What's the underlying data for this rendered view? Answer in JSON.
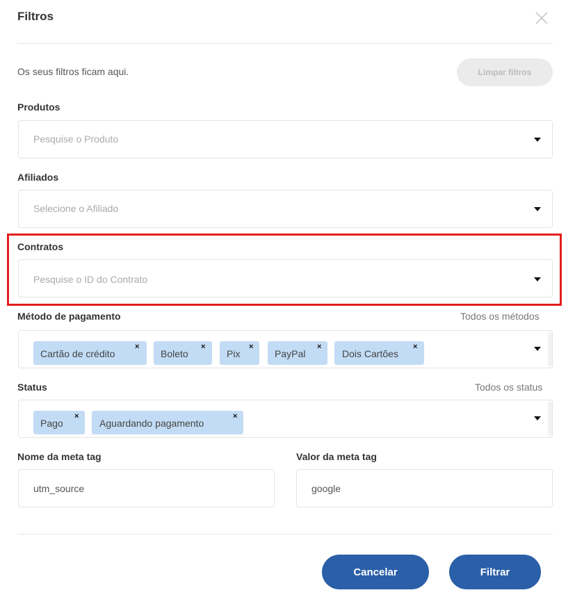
{
  "modal": {
    "title": "Filtros",
    "subtitle": "Os seus filtros ficam aqui.",
    "clear_label": "Limpar filtros"
  },
  "products": {
    "label": "Produtos",
    "placeholder": "Pesquise o Produto"
  },
  "affiliates": {
    "label": "Afiliados",
    "placeholder": "Selecione o Afiliado"
  },
  "contracts": {
    "label": "Contratos",
    "placeholder": "Pesquise o ID do Contrato"
  },
  "payment": {
    "label": "Método de pagamento",
    "hint": "Todos os métodos",
    "chips": [
      "Cartão de crédito",
      "Boleto",
      "Pix",
      "PayPal",
      "Dois Cartões"
    ]
  },
  "status": {
    "label": "Status",
    "hint": "Todos os status",
    "chips": [
      "Pago",
      "Aguardando pagamento"
    ]
  },
  "meta_name": {
    "label": "Nome da meta tag",
    "value": "utm_source"
  },
  "meta_value": {
    "label": "Valor da meta tag",
    "value": "google"
  },
  "footer": {
    "cancel_label": "Cancelar",
    "filter_label": "Filtrar"
  },
  "chip_remove_glyph": "×",
  "colors": {
    "primary": "#2b5fa8",
    "chip": "#c3dcf5",
    "highlight": "#e41e1e",
    "disabled_button": "#ebebeb"
  }
}
